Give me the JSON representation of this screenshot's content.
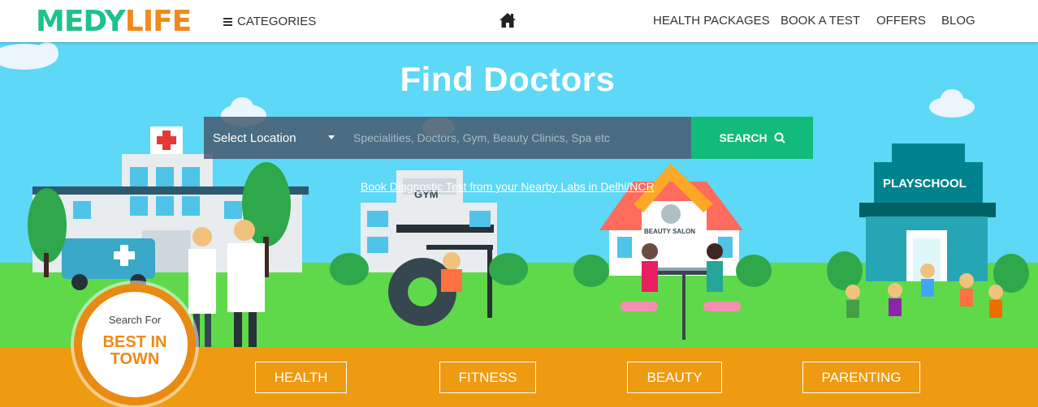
{
  "brand": {
    "part1": "MEDY",
    "part2": "LIFE"
  },
  "header": {
    "categories_label": "CATEGORIES",
    "nav": [
      {
        "label": "HEALTH PACKAGES"
      },
      {
        "label": "BOOK A TEST"
      },
      {
        "label": "OFFERS"
      },
      {
        "label": "BLOG"
      }
    ]
  },
  "hero": {
    "title": "Find Doctors",
    "location_select": "Select Location",
    "search_placeholder": "Specialities, Doctors, Gym, Beauty Clinics, Spa etc",
    "search_button": "SEARCH",
    "book_test_link": "Book Diagnostic Test from your Nearby Labs in Delhi/NCR",
    "illustration_labels": {
      "gym": "GYM",
      "salon": "BEAUTY SALON",
      "school": "PLAYSCHOOL"
    }
  },
  "badge": {
    "line1": "Search For",
    "line2": "BEST IN",
    "line3": "TOWN"
  },
  "categories": [
    {
      "label": "HEALTH"
    },
    {
      "label": "FITNESS"
    },
    {
      "label": "BEAUTY"
    },
    {
      "label": "PARENTING"
    }
  ],
  "colors": {
    "accent_green": "#13bb7a",
    "brand_orange": "#ef9b12",
    "sky": "#5dd8f6",
    "grass": "#5fd94a"
  }
}
